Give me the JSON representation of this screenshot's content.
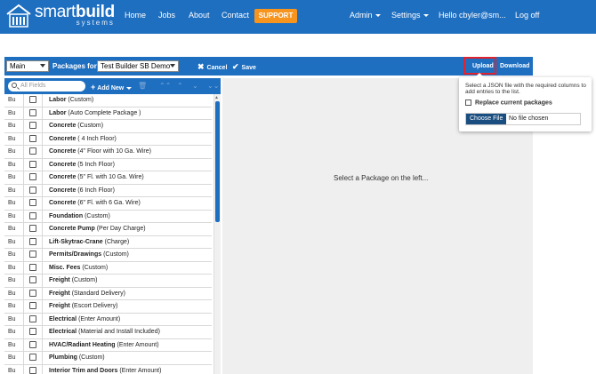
{
  "brand": {
    "name_part1": "smart",
    "name_part2": "build",
    "tagline": "systems"
  },
  "nav": {
    "home": "Home",
    "jobs": "Jobs",
    "about": "About",
    "contact": "Contact",
    "support": "SUPPORT",
    "admin": "Admin",
    "settings": "Settings",
    "user": "Hello cbyler@sm...",
    "logoff": "Log off"
  },
  "toolbar": {
    "main_select": "Main",
    "packages_for_label": "Packages for",
    "builder_select": "Test Builder SB Demo",
    "cancel_label": "Cancel",
    "save_label": "Save",
    "upload_label": "Upload",
    "download_label": "Download"
  },
  "list_toolbar": {
    "search_placeholder": "All Fields",
    "add_new_label": "Add New"
  },
  "packages": [
    {
      "type": "Bu",
      "name": "Labor",
      "detail": "(Custom)"
    },
    {
      "type": "Bu",
      "name": "Labor",
      "detail": "(Auto Complete Package )"
    },
    {
      "type": "Bu",
      "name": "Concrete",
      "detail": "(Custom)"
    },
    {
      "type": "Bu",
      "name": "Concrete",
      "detail": "( 4 Inch Floor)"
    },
    {
      "type": "Bu",
      "name": "Concrete",
      "detail": "(4\" Floor with 10 Ga. Wire)"
    },
    {
      "type": "Bu",
      "name": "Concrete",
      "detail": "(5 Inch Floor)"
    },
    {
      "type": "Bu",
      "name": "Concrete",
      "detail": "(5\" Fl. with 10 Ga. Wire)"
    },
    {
      "type": "Bu",
      "name": "Concrete",
      "detail": "(6 Inch Floor)"
    },
    {
      "type": "Bu",
      "name": "Concrete",
      "detail": "(6\" Fl. with 6 Ga. Wire)"
    },
    {
      "type": "Bu",
      "name": "Foundation",
      "detail": "(Custom)"
    },
    {
      "type": "Bu",
      "name": "Concrete Pump",
      "detail": "(Per Day Charge)"
    },
    {
      "type": "Bu",
      "name": "Lift-Skytrac-Crane",
      "detail": "(Charge)"
    },
    {
      "type": "Bu",
      "name": "Permits/Drawings",
      "detail": "(Custom)"
    },
    {
      "type": "Bu",
      "name": "Misc. Fees",
      "detail": "(Custom)"
    },
    {
      "type": "Bu",
      "name": "Freight",
      "detail": "(Custom)"
    },
    {
      "type": "Bu",
      "name": "Freight",
      "detail": "(Standard Delivery)"
    },
    {
      "type": "Bu",
      "name": "Freight",
      "detail": "(Escort Delivery)"
    },
    {
      "type": "Bu",
      "name": "Electrical",
      "detail": "(Enter Amount)"
    },
    {
      "type": "Bu",
      "name": "Electrical",
      "detail": "(Material and Install Included)"
    },
    {
      "type": "Bu",
      "name": "HVAC/Radiant Heating",
      "detail": "(Enter Amount)"
    },
    {
      "type": "Bu",
      "name": "Plumbing",
      "detail": "(Custom)"
    },
    {
      "type": "Bu",
      "name": "Interior Trim and Doors",
      "detail": "(Enter Amount)"
    }
  ],
  "right_panel": {
    "placeholder": "Select a Package on the left..."
  },
  "upload_popover": {
    "description": "Select a JSON file with the required columns to add entries to the list.",
    "replace_label": "Replace current packages",
    "choose_file_label": "Choose File",
    "no_file_label": "No file chosen"
  },
  "colors": {
    "primary": "#1f6fc1",
    "support": "#f7941d",
    "highlight": "#e0232e"
  }
}
